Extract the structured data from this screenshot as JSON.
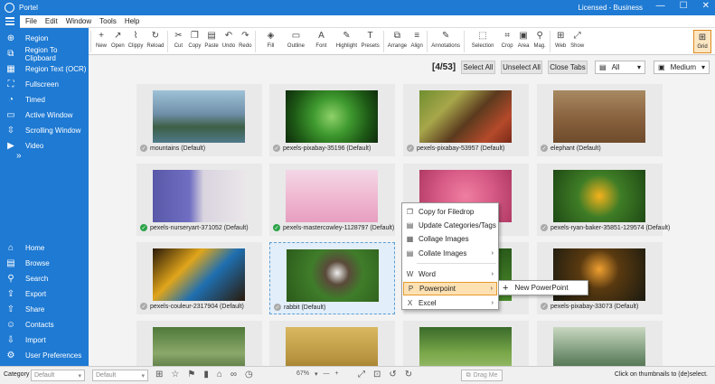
{
  "window": {
    "title": "Portel",
    "license": "Licensed - Business",
    "minimize": "—",
    "maximize": "☐",
    "close": "✕"
  },
  "menu": [
    "File",
    "Edit",
    "Window",
    "Tools",
    "Help"
  ],
  "ribbon": {
    "buttons": [
      {
        "label": "New",
        "icon": "plus-icon",
        "glyph": "+"
      },
      {
        "label": "Open",
        "icon": "open-icon",
        "glyph": "↗"
      },
      {
        "label": "Clippy",
        "icon": "paperclip-icon",
        "glyph": "⌇"
      },
      {
        "label": "Reload",
        "icon": "reload-icon",
        "glyph": "↻"
      },
      {
        "label": "Cut",
        "icon": "scissors-icon",
        "glyph": "✂"
      },
      {
        "label": "Copy",
        "icon": "copy-icon",
        "glyph": "❐"
      },
      {
        "label": "Paste",
        "icon": "paste-icon",
        "glyph": "▤"
      },
      {
        "label": "Undo",
        "icon": "undo-icon",
        "glyph": "↶"
      },
      {
        "label": "Redo",
        "icon": "redo-icon",
        "glyph": "↷"
      },
      {
        "label": "Fill",
        "icon": "fill-icon",
        "glyph": "◈"
      },
      {
        "label": "Outline",
        "icon": "outline-icon",
        "glyph": "▭"
      },
      {
        "label": "Font",
        "icon": "font-icon",
        "glyph": "A"
      },
      {
        "label": "Highlight",
        "icon": "highlight-icon",
        "glyph": "✎"
      },
      {
        "label": "Presets",
        "icon": "presets-icon",
        "glyph": "T"
      },
      {
        "label": "Arrange",
        "icon": "arrange-icon",
        "glyph": "⧉"
      },
      {
        "label": "Align",
        "icon": "align-icon",
        "glyph": "≡"
      },
      {
        "label": "Annotations",
        "icon": "annotations-icon",
        "glyph": "✎"
      },
      {
        "label": "Selection",
        "icon": "selection-icon",
        "glyph": "⬚"
      },
      {
        "label": "Crop",
        "icon": "crop-icon",
        "glyph": "⌗"
      },
      {
        "label": "Area",
        "icon": "area-icon",
        "glyph": "▣"
      },
      {
        "label": "Mag.",
        "icon": "magnifier-icon",
        "glyph": "⚲"
      },
      {
        "label": "Web",
        "icon": "web-icon",
        "glyph": "⊞"
      },
      {
        "label": "Show",
        "icon": "show-icon",
        "glyph": "⤢"
      }
    ],
    "font_size": "20",
    "line_size": "6",
    "grid_label": "Grid"
  },
  "sidebar": {
    "top": [
      {
        "label": "Region",
        "icon": "region-icon",
        "glyph": "⊕"
      },
      {
        "label": "Region To Clipboard",
        "icon": "clipboard-icon",
        "glyph": "⧉"
      },
      {
        "label": "Region Text (OCR)",
        "icon": "ocr-icon",
        "glyph": "▦"
      },
      {
        "label": "Fullscreen",
        "icon": "fullscreen-icon",
        "glyph": "⛶"
      },
      {
        "label": "Timed",
        "icon": "timer-icon",
        "glyph": "◔"
      },
      {
        "label": "Active Window",
        "icon": "window-icon",
        "glyph": "▭"
      },
      {
        "label": "Scrolling Window",
        "icon": "scroll-window-icon",
        "glyph": "⇳"
      },
      {
        "label": "Video",
        "icon": "video-icon",
        "glyph": "▶"
      }
    ],
    "expand": "»",
    "bottom": [
      {
        "label": "Home",
        "icon": "home-icon",
        "glyph": "⌂"
      },
      {
        "label": "Browse",
        "icon": "browse-icon",
        "glyph": "▤"
      },
      {
        "label": "Search",
        "icon": "search-icon",
        "glyph": "⚲"
      },
      {
        "label": "Export",
        "icon": "export-icon",
        "glyph": "⇪"
      },
      {
        "label": "Share",
        "icon": "share-icon",
        "glyph": "⇧"
      },
      {
        "label": "Contacts",
        "icon": "contacts-icon",
        "glyph": "☺"
      },
      {
        "label": "Import",
        "icon": "import-icon",
        "glyph": "⇩"
      },
      {
        "label": "User Preferences",
        "icon": "preferences-icon",
        "glyph": "⚙"
      }
    ]
  },
  "toolbar": {
    "counter": "[4/53]",
    "select_all": "Select All",
    "unselect_all": "Unselect All",
    "close_tabs": "Close Tabs",
    "filter_value": "All",
    "size_value": "Medium"
  },
  "thumbnails": [
    {
      "caption": "mountains (Default)",
      "checked": false
    },
    {
      "caption": "pexels-pixabay-35196 (Default)",
      "checked": false
    },
    {
      "caption": "pexels-pixabay-53957 (Default)",
      "checked": false
    },
    {
      "caption": "elephant (Default)",
      "checked": false
    },
    {
      "caption": "pexels-nurseryart-371052 (Default)",
      "checked": true
    },
    {
      "caption": "pexels-mastercowley-1128797 (Default)",
      "checked": true
    },
    {
      "caption": "",
      "checked": false
    },
    {
      "caption": "pexels-ryan-baker-35851-129574 (Default)",
      "checked": false
    },
    {
      "caption": "pexels-couleur-2317904 (Default)",
      "checked": false
    },
    {
      "caption": "rabbit (Default)",
      "checked": false
    },
    {
      "caption": "",
      "checked": false
    },
    {
      "caption": "pexels-pixabay-33073 (Default)",
      "checked": false
    },
    {
      "caption": "",
      "checked": false
    },
    {
      "caption": "",
      "checked": false
    },
    {
      "caption": "",
      "checked": false
    },
    {
      "caption": "",
      "checked": false
    }
  ],
  "context_menu": {
    "items": [
      {
        "label": "Copy for Filedrop",
        "icon": "copy-icon",
        "glyph": "❐",
        "arrow": ""
      },
      {
        "label": "Update Categories/Tags",
        "icon": "tag-icon",
        "glyph": "▤",
        "arrow": ""
      },
      {
        "label": "Collage Images",
        "icon": "collage-icon",
        "glyph": "▦",
        "arrow": ""
      },
      {
        "label": "Collate Images",
        "icon": "collate-icon",
        "glyph": "▤",
        "arrow": "›"
      },
      {
        "label": "Word",
        "icon": "word-icon",
        "glyph": "W",
        "arrow": "›"
      },
      {
        "label": "Powerpoint",
        "icon": "powerpoint-icon",
        "glyph": "P",
        "arrow": "›"
      },
      {
        "label": "Excel",
        "icon": "excel-icon",
        "glyph": "X",
        "arrow": "›"
      }
    ],
    "submenu_item": "New PowerPoint"
  },
  "statusbar": {
    "category_label": "Category",
    "category_value": "Default",
    "second_value": "Default",
    "zoom": "67%",
    "drag_me": "Drag Me",
    "hint": "Click on thumbnails to (de)select."
  },
  "colors": {
    "accent": "#1e7ad3",
    "highlight": "#fde1b3",
    "check": "#2da34a"
  }
}
